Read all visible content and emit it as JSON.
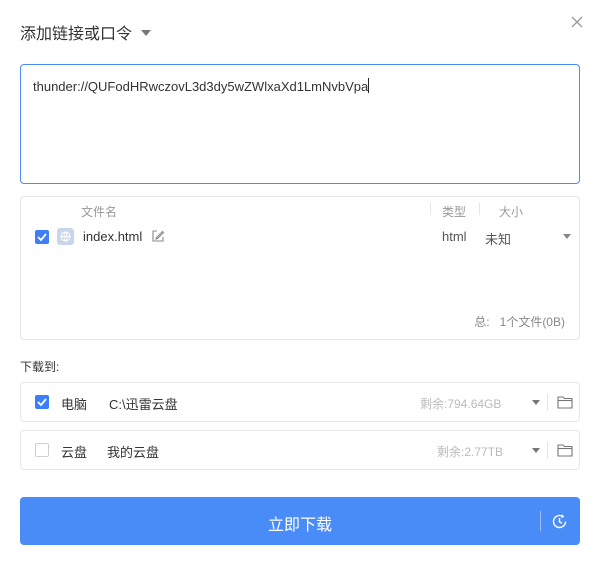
{
  "header": {
    "title": "添加链接或口令"
  },
  "link": {
    "value": "thunder://QUFodHRwczovL3d3dy5wZWlxaXd1LmNvbVpa"
  },
  "files": {
    "columns": {
      "name": "文件名",
      "type": "类型",
      "size": "大小"
    },
    "rows": [
      {
        "checked": true,
        "name": "index.html",
        "type": "html",
        "size": "未知"
      }
    ],
    "total_label": "总:",
    "total_value": "1个文件(0B)"
  },
  "destination": {
    "label": "下载到:",
    "options": [
      {
        "checked": true,
        "name": "电脑",
        "path": "C:\\迅雷云盘",
        "free": "剩余:794.64GB"
      },
      {
        "checked": false,
        "name": "云盘",
        "path": "我的云盘",
        "free": "剩余:2.77TB"
      }
    ]
  },
  "actions": {
    "download_label": "立即下载"
  },
  "colors": {
    "accent": "#4a8cf7",
    "checkbox": "#3e7ef7"
  }
}
